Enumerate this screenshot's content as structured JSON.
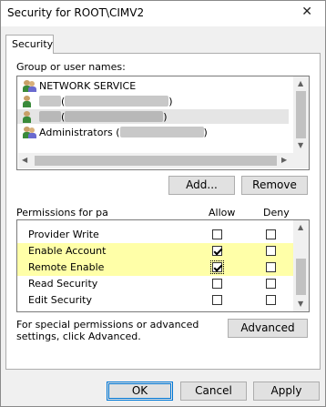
{
  "window": {
    "title": "Security for ROOT\\CIMV2",
    "close_glyph": "✕"
  },
  "tabs": [
    {
      "label": "Security"
    }
  ],
  "group_label": "Group or user names:",
  "users": [
    {
      "name": "NETWORK SERVICE",
      "suffix": ""
    },
    {
      "name": "",
      "suffix": "("
    },
    {
      "name": "",
      "suffix": "("
    },
    {
      "name": "Administrators",
      "suffix": "("
    }
  ],
  "list_buttons": {
    "add": "Add...",
    "remove": "Remove"
  },
  "permissions": {
    "label": "Permissions for pa",
    "allow_header": "Allow",
    "deny_header": "Deny",
    "rows": [
      {
        "name": "Provider Write",
        "allow": false,
        "deny": false
      },
      {
        "name": "Enable Account",
        "allow": true,
        "deny": false
      },
      {
        "name": "Remote Enable",
        "allow": true,
        "deny": false
      },
      {
        "name": "Read Security",
        "allow": false,
        "deny": false
      },
      {
        "name": "Edit Security",
        "allow": false,
        "deny": false
      }
    ]
  },
  "advanced_text": "For special permissions or advanced settings, click Advanced.",
  "advanced_button": "Advanced",
  "footer": {
    "ok": "OK",
    "cancel": "Cancel",
    "apply": "Apply"
  }
}
